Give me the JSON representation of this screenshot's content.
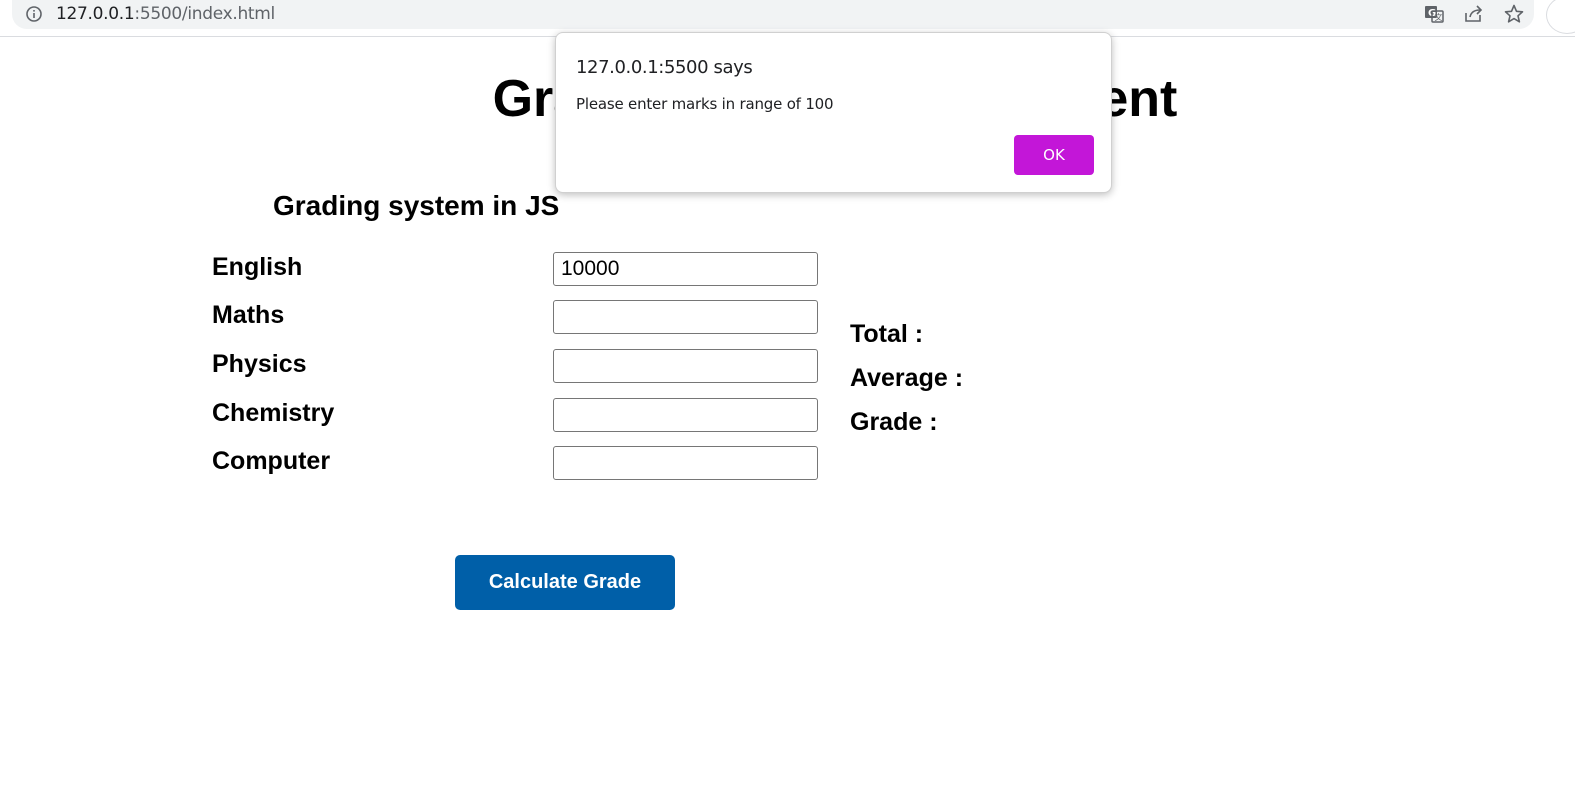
{
  "browser": {
    "url_host": "127.0.0.1",
    "url_rest": ":5500/index.html",
    "icons": [
      "info-icon",
      "translate-icon",
      "share-icon",
      "bookmark-star-icon",
      "profile-icon"
    ]
  },
  "page": {
    "title": "Grading system for Student",
    "section_title": "Grading system in JS"
  },
  "subjects": [
    {
      "label": "English",
      "value": "10000",
      "placeholder": ""
    },
    {
      "label": "Maths",
      "value": "",
      "placeholder": ""
    },
    {
      "label": "Physics",
      "value": "",
      "placeholder": ""
    },
    {
      "label": "Chemistry",
      "value": "",
      "placeholder": ""
    },
    {
      "label": "Computer",
      "value": "",
      "placeholder": ""
    }
  ],
  "results": {
    "total_label": "Total :",
    "average_label": "Average :",
    "grade_label": "Grade :"
  },
  "button": {
    "calculate_label": "Calculate Grade"
  },
  "alert": {
    "origin": "127.0.0.1:5500 says",
    "message": "Please enter marks in range of 100",
    "ok_label": "OK"
  },
  "colors": {
    "calculate_button": "#005fa8",
    "ok_button": "#c316d8"
  }
}
